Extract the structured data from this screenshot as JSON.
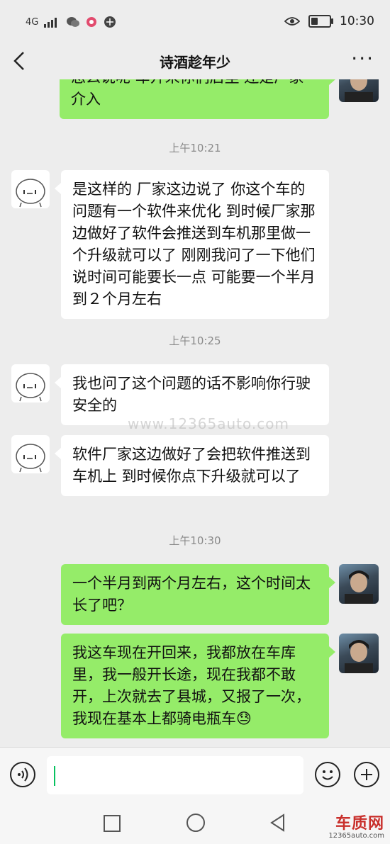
{
  "status_bar": {
    "network": "4G",
    "time": "10:30"
  },
  "header": {
    "title": "诗酒趁年少",
    "back_icon": "chevron-left-icon",
    "more_label": "···"
  },
  "messages": [
    {
      "side": "right",
      "text": "怎么说呢 车开来你们店里 还是厂家介入",
      "partial": true
    },
    {
      "timestamp": "上午10:21"
    },
    {
      "side": "left",
      "text": "是这样的  厂家这边说了 你这个车的问题有一个软件来优化  到时候厂家那边做好了软件会推送到车机那里做一个升级就可以了  刚刚我问了一下他们说时间可能要长一点  可能要一个半月到２个月左右"
    },
    {
      "timestamp": "上午10:25"
    },
    {
      "side": "left",
      "text": "我也问了这个问题的话不影响你行驶安全的"
    },
    {
      "side": "left",
      "text": "软件厂家这边做好了会把软件推送到车机上  到时候你点下升级就可以了"
    },
    {
      "timestamp": "上午10:30"
    },
    {
      "side": "right",
      "text": "一个半月到两个月左右，这个时间太长了吧？"
    },
    {
      "side": "right",
      "text": "我这车现在开回来，我都放在车库里，我一般开长途，现在我都不敢开，上次就去了县城，又报了一次，我现在基本上都骑电瓶车😓"
    }
  ],
  "watermark": "www.12365auto.com",
  "input_bar": {
    "voice_icon": "voice-icon",
    "emoji_icon": "emoji-icon",
    "plus_icon": "plus-icon"
  },
  "logo": {
    "main": "车质网",
    "sub": "12365auto.com"
  }
}
